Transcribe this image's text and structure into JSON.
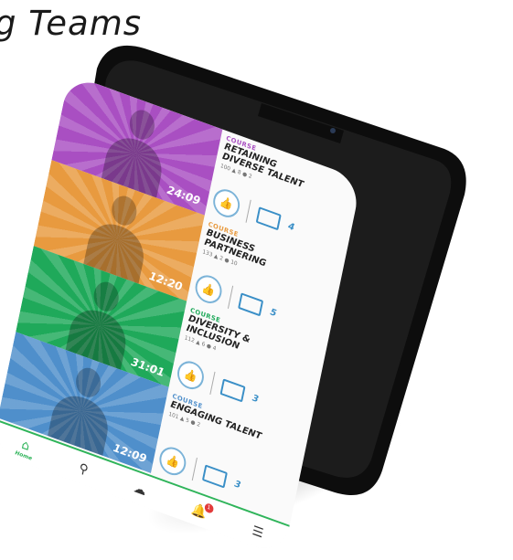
{
  "headline": "g Teams",
  "courses": [
    {
      "kind": "COURSE",
      "title": "RETAINING DIVERSE TALENT",
      "stats": "100 ▲ 8 ● 2",
      "duration": "24:09",
      "screens": "4",
      "color": "#a94fc2",
      "accent": "#a94fc2"
    },
    {
      "kind": "COURSE",
      "title": "BUSINESS PARTNERING",
      "stats": "133 ▲ 2 ● 10",
      "duration": "12:20",
      "screens": "5",
      "color": "#e89a3f",
      "accent": "#e89a3f"
    },
    {
      "kind": "COURSE",
      "title": "DIVERSITY & INCLUSION",
      "stats": "112 ▲ 6 ● 4",
      "duration": "31:01",
      "screens": "3",
      "color": "#1fa95a",
      "accent": "#1fa95a"
    },
    {
      "kind": "COURSE",
      "title": "ENGAGING TALENT",
      "stats": "101 ▲ 5 ● 2",
      "duration": "12:09",
      "screens": "3",
      "color": "#4f8fcb",
      "accent": "#4f8fcb"
    }
  ],
  "nav": {
    "home_label": "Home",
    "home_icon": "home-icon",
    "search_icon": "search-icon",
    "chat_icon": "chat-icon",
    "bell_icon": "bell-icon",
    "bell_badge": "1",
    "menu_icon": "menu-icon"
  }
}
